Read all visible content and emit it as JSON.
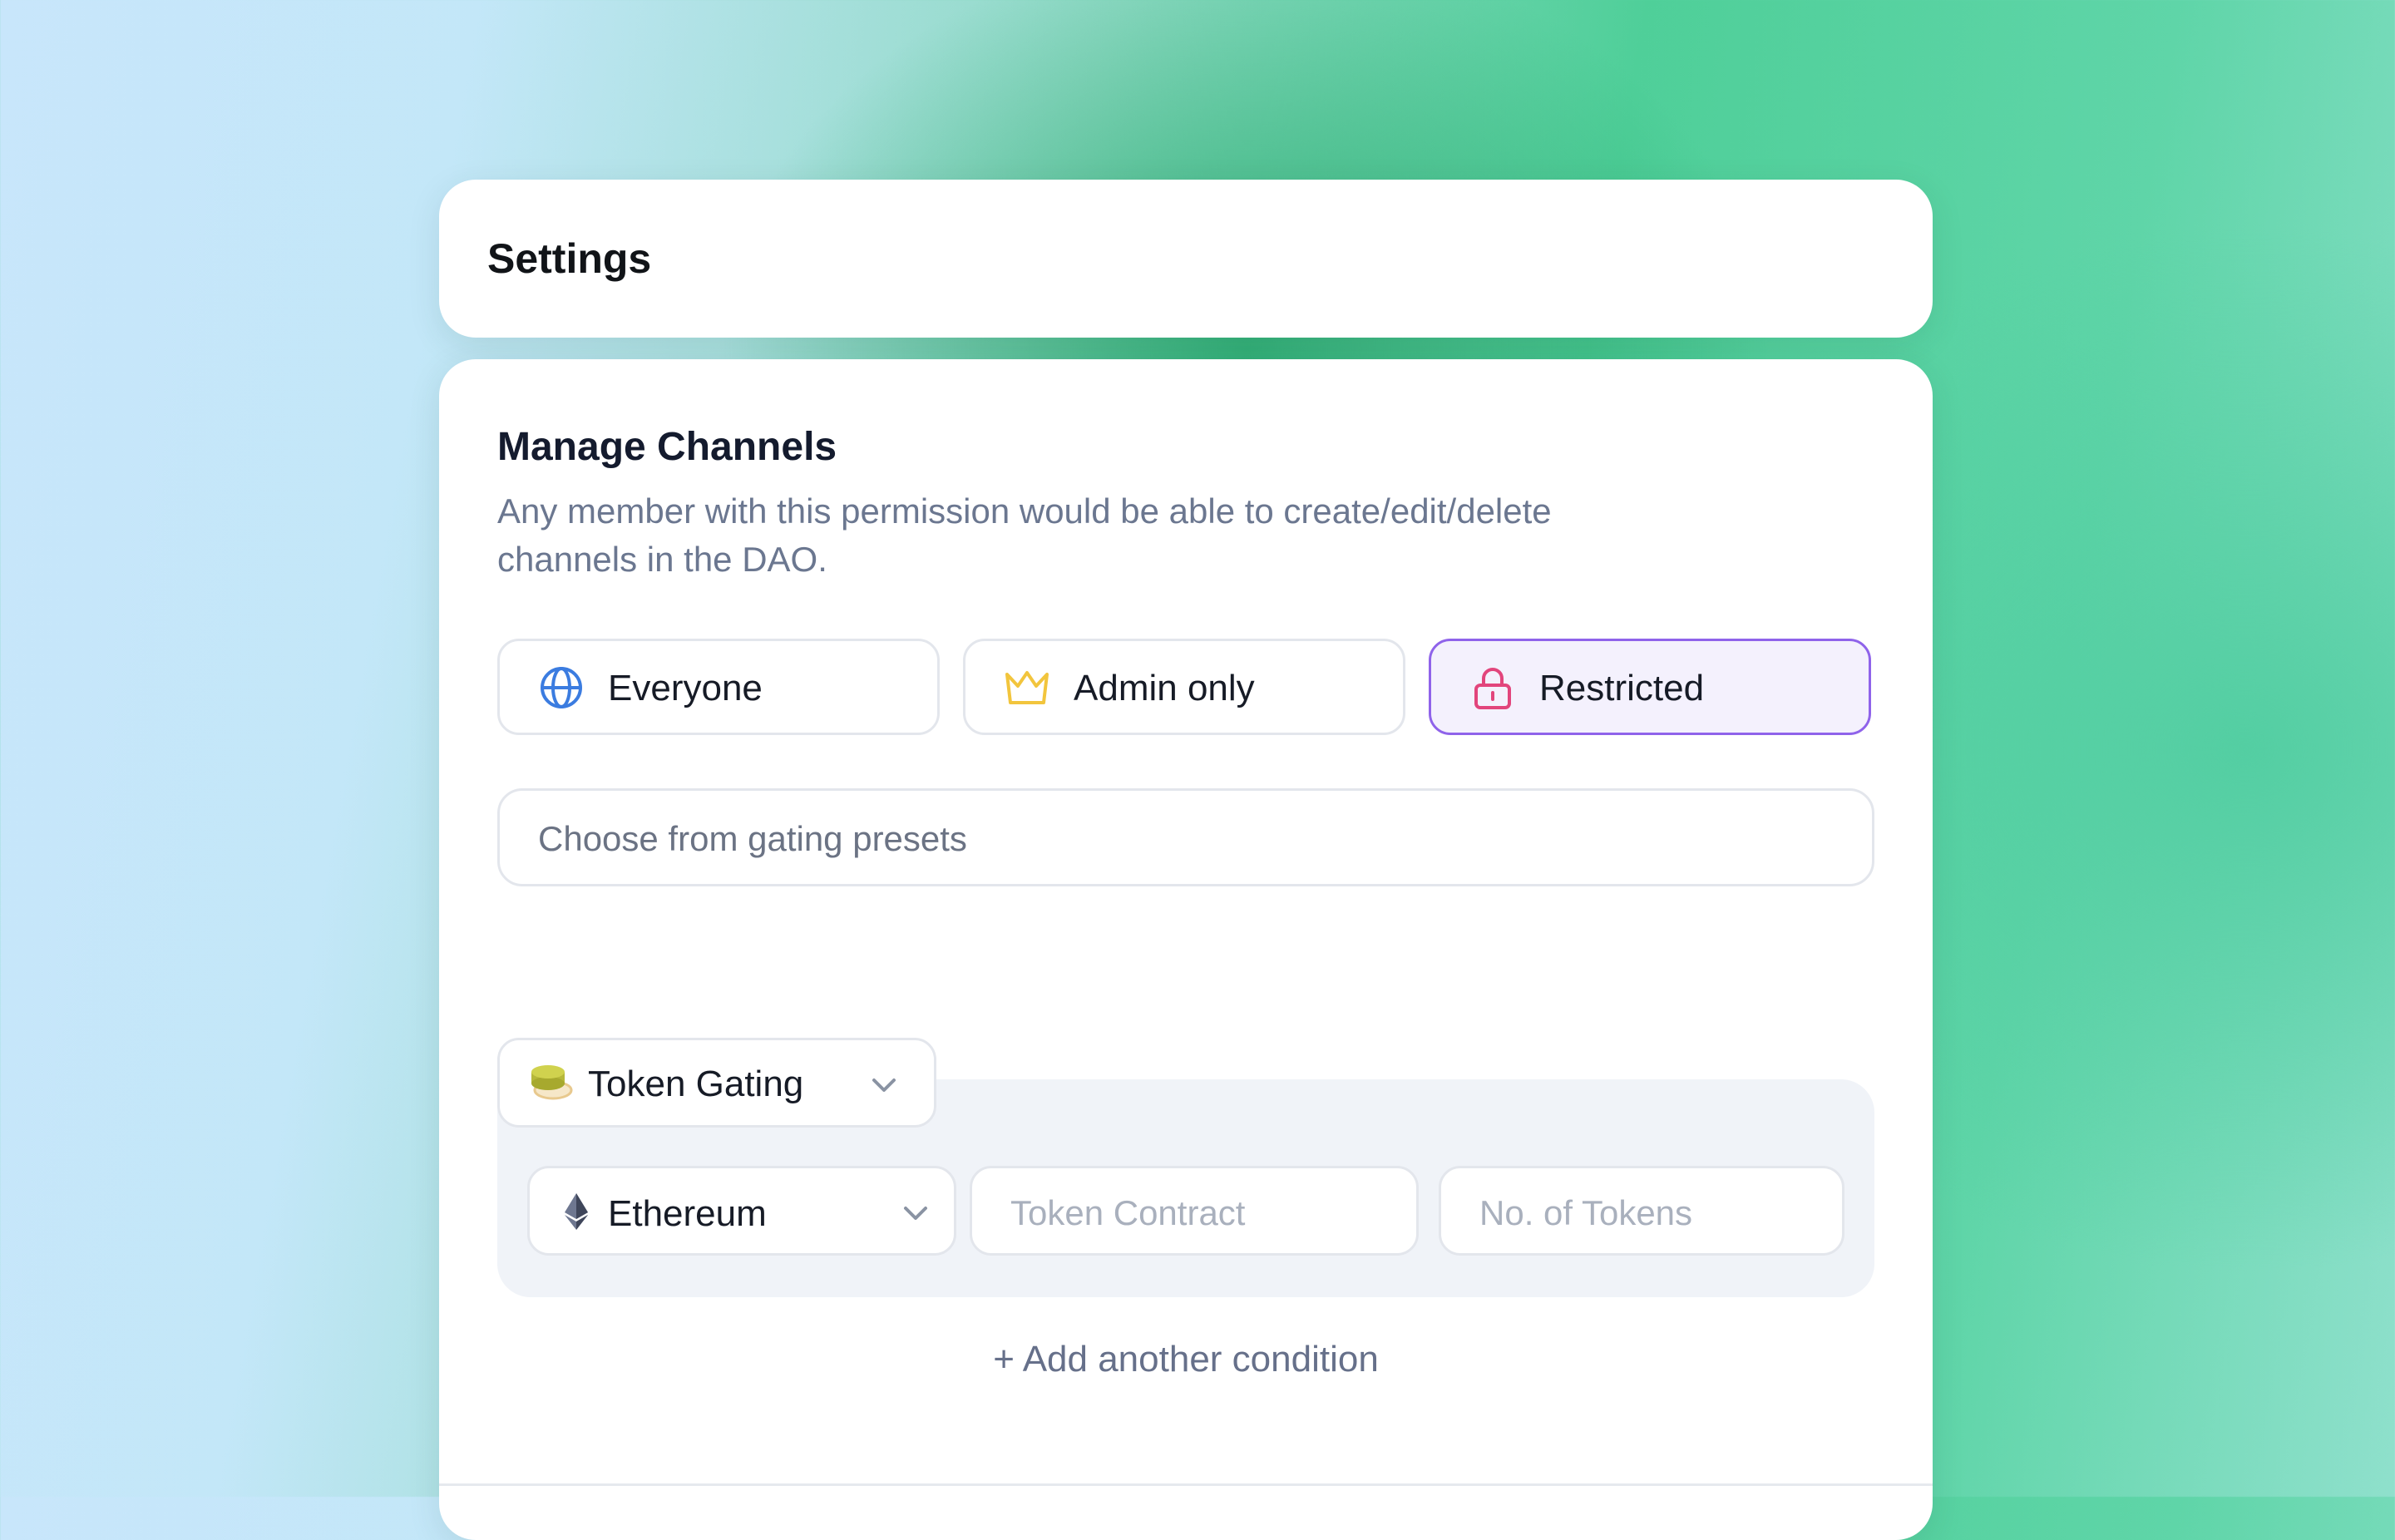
{
  "settings": {
    "title": "Settings"
  },
  "manage_channels": {
    "title": "Manage Channels",
    "description_line1": "Any member with this permission would be able to create/edit/delete",
    "description_line2": "channels in the DAO.",
    "options": [
      {
        "label": "Everyone",
        "icon": "globe-icon",
        "selected": false
      },
      {
        "label": "Admin only",
        "icon": "crown-icon",
        "selected": false
      },
      {
        "label": "Restricted",
        "icon": "lock-icon",
        "selected": true
      }
    ],
    "preset_placeholder": "Choose from gating presets",
    "gating": {
      "type_label": "Token Gating",
      "type_icon": "coins-icon",
      "chain_label": "Ethereum",
      "chain_icon": "ethereum-icon",
      "token_contract_placeholder": "Token Contract",
      "token_count_placeholder": "No. of Tokens"
    },
    "add_condition_label": "+ Add another condition"
  },
  "colors": {
    "accent_purple": "#8f63ea",
    "selected_bg": "#f4f1fd",
    "globe_blue": "#3b7ce0",
    "crown_yellow": "#f2c53d",
    "lock_pink": "#e2457c",
    "coin_olive": "#b6b83a"
  }
}
